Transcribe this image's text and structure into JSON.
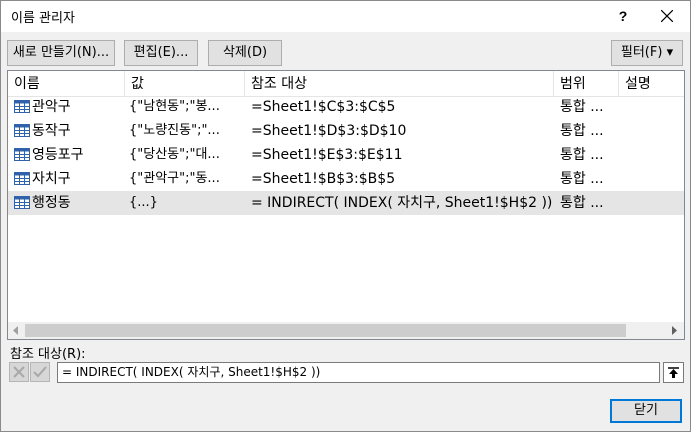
{
  "window": {
    "title": "이름 관리자",
    "help": "?"
  },
  "toolbar": {
    "new_label": "새로 만들기(N)...",
    "edit_label": "편집(E)...",
    "delete_label": "삭제(D)",
    "filter_label": "필터(F) ▾"
  },
  "columns": {
    "name": "이름",
    "value": "값",
    "refers_to": "참조 대상",
    "scope": "범위",
    "comment": "설명"
  },
  "rows": [
    {
      "name": "관악구",
      "value": "{\"남현동\";\"봉...",
      "refers_to": "=Sheet1!$C$3:$C$5",
      "scope": "통합 ..."
    },
    {
      "name": "동작구",
      "value": "{\"노량진동\";\"...",
      "refers_to": "=Sheet1!$D$3:$D$10",
      "scope": "통합 ..."
    },
    {
      "name": "영등포구",
      "value": "{\"당산동\";\"대...",
      "refers_to": "=Sheet1!$E$3:$E$11",
      "scope": "통합 ..."
    },
    {
      "name": "자치구",
      "value": "{\"관악구\";\"동...",
      "refers_to": "=Sheet1!$B$3:$B$5",
      "scope": "통합 ..."
    },
    {
      "name": "행정동",
      "value": "{...}",
      "refers_to": "= INDIRECT( INDEX( 자치구, Sheet1!$H$2 ))",
      "scope": "통합 ..."
    }
  ],
  "selected_row": 4,
  "refers_to_panel": {
    "label": "참조 대상(R):",
    "value": "= INDIRECT( INDEX( 자치구, Sheet1!$H$2 ))"
  },
  "footer": {
    "close_label": "닫기"
  },
  "colors": {
    "selection": "#e5e5e5",
    "dialog_bg": "#f0f0f0",
    "button_bg": "#e1e1e1",
    "focus_border": "#0078d7"
  }
}
